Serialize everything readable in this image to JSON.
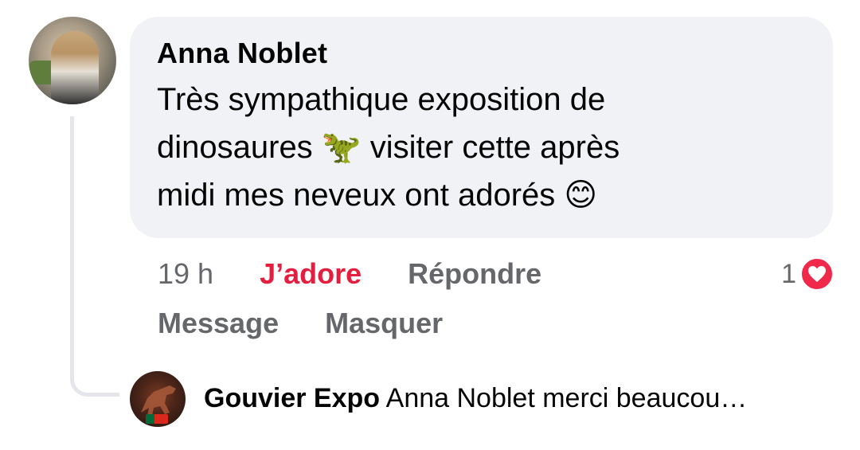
{
  "comment": {
    "author": "Anna Noblet",
    "text": "Très sympathique exposition de dinosaures",
    "text_line1": "Très sympathique exposition de",
    "text_line2_a": "dinosaures",
    "emoji_dino": "🦖",
    "text_line2_b": "visiter cette après",
    "text_line3": "midi mes neveux ont adorés",
    "emoji_smile": "😊"
  },
  "actions": {
    "time": "19 h",
    "like_label": "J’adore",
    "reply_label": "Répondre",
    "message_label": "Message",
    "hide_label": "Masquer",
    "reaction_count": "1",
    "reaction_icon": "heart-icon"
  },
  "reply": {
    "author": "Gouvier Expo",
    "preview": "Anna Noblet merci beaucou…"
  },
  "colors": {
    "bubble": "#f0f2f5",
    "liked": "#e41e3f",
    "muted": "#65676b",
    "heart": "#f02849"
  }
}
